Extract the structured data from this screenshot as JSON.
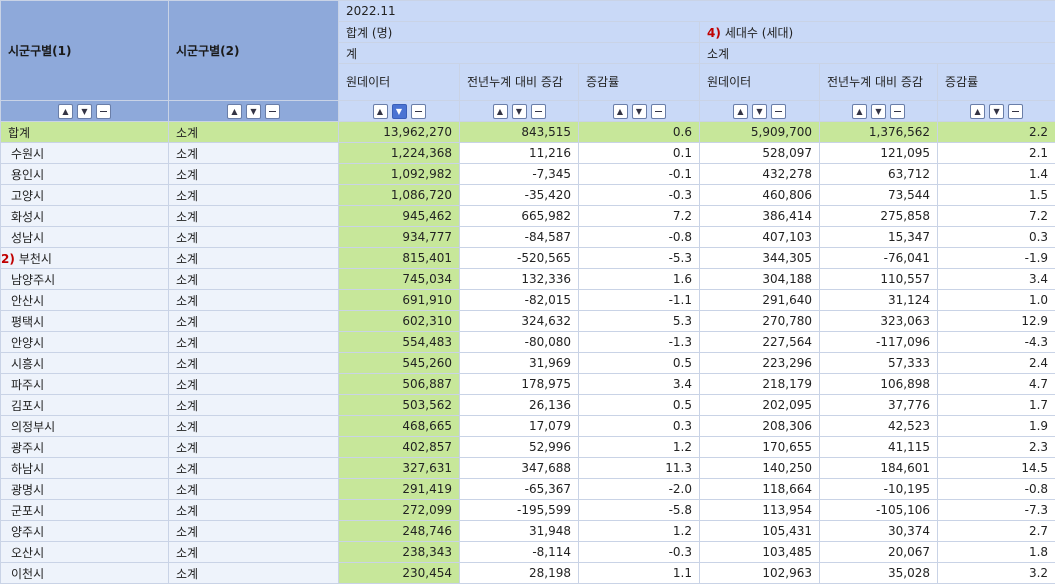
{
  "header": {
    "col1_label": "시군구별(1)",
    "col2_label": "시군구별(2)",
    "period": "2022.11",
    "group1_label": "합계 (명)",
    "group1_sub": "계",
    "group2_marker": "4)",
    "group2_label": "세대수 (세대)",
    "group2_sub": "소계",
    "metric_raw": "원데이터",
    "metric_change": "전년누계 대비 증감",
    "metric_rate": "증감률"
  },
  "rows": [
    {
      "region": "합계",
      "sub": "소계",
      "pop": "13,962,270",
      "pop_chg": "843,515",
      "pop_rate": "0.6",
      "hh": "5,909,700",
      "hh_chg": "1,376,562",
      "hh_rate": "2.2"
    },
    {
      "region": "수원시",
      "sub": "소계",
      "pop": "1,224,368",
      "pop_chg": "11,216",
      "pop_rate": "0.1",
      "hh": "528,097",
      "hh_chg": "121,095",
      "hh_rate": "2.1"
    },
    {
      "region": "용인시",
      "sub": "소계",
      "pop": "1,092,982",
      "pop_chg": "-7,345",
      "pop_rate": "-0.1",
      "hh": "432,278",
      "hh_chg": "63,712",
      "hh_rate": "1.4"
    },
    {
      "region": "고양시",
      "sub": "소계",
      "pop": "1,086,720",
      "pop_chg": "-35,420",
      "pop_rate": "-0.3",
      "hh": "460,806",
      "hh_chg": "73,544",
      "hh_rate": "1.5"
    },
    {
      "region": "화성시",
      "sub": "소계",
      "pop": "945,462",
      "pop_chg": "665,982",
      "pop_rate": "7.2",
      "hh": "386,414",
      "hh_chg": "275,858",
      "hh_rate": "7.2"
    },
    {
      "region": "성남시",
      "sub": "소계",
      "pop": "934,777",
      "pop_chg": "-84,587",
      "pop_rate": "-0.8",
      "hh": "407,103",
      "hh_chg": "15,347",
      "hh_rate": "0.3"
    },
    {
      "region": "부천시",
      "marker": "2)",
      "sub": "소계",
      "pop": "815,401",
      "pop_chg": "-520,565",
      "pop_rate": "-5.3",
      "hh": "344,305",
      "hh_chg": "-76,041",
      "hh_rate": "-1.9"
    },
    {
      "region": "남양주시",
      "sub": "소계",
      "pop": "745,034",
      "pop_chg": "132,336",
      "pop_rate": "1.6",
      "hh": "304,188",
      "hh_chg": "110,557",
      "hh_rate": "3.4"
    },
    {
      "region": "안산시",
      "sub": "소계",
      "pop": "691,910",
      "pop_chg": "-82,015",
      "pop_rate": "-1.1",
      "hh": "291,640",
      "hh_chg": "31,124",
      "hh_rate": "1.0"
    },
    {
      "region": "평택시",
      "sub": "소계",
      "pop": "602,310",
      "pop_chg": "324,632",
      "pop_rate": "5.3",
      "hh": "270,780",
      "hh_chg": "323,063",
      "hh_rate": "12.9"
    },
    {
      "region": "안양시",
      "sub": "소계",
      "pop": "554,483",
      "pop_chg": "-80,080",
      "pop_rate": "-1.3",
      "hh": "227,564",
      "hh_chg": "-117,096",
      "hh_rate": "-4.3"
    },
    {
      "region": "시흥시",
      "sub": "소계",
      "pop": "545,260",
      "pop_chg": "31,969",
      "pop_rate": "0.5",
      "hh": "223,296",
      "hh_chg": "57,333",
      "hh_rate": "2.4"
    },
    {
      "region": "파주시",
      "sub": "소계",
      "pop": "506,887",
      "pop_chg": "178,975",
      "pop_rate": "3.4",
      "hh": "218,179",
      "hh_chg": "106,898",
      "hh_rate": "4.7"
    },
    {
      "region": "김포시",
      "sub": "소계",
      "pop": "503,562",
      "pop_chg": "26,136",
      "pop_rate": "0.5",
      "hh": "202,095",
      "hh_chg": "37,776",
      "hh_rate": "1.7"
    },
    {
      "region": "의정부시",
      "sub": "소계",
      "pop": "468,665",
      "pop_chg": "17,079",
      "pop_rate": "0.3",
      "hh": "208,306",
      "hh_chg": "42,523",
      "hh_rate": "1.9"
    },
    {
      "region": "광주시",
      "sub": "소계",
      "pop": "402,857",
      "pop_chg": "52,996",
      "pop_rate": "1.2",
      "hh": "170,655",
      "hh_chg": "41,115",
      "hh_rate": "2.3"
    },
    {
      "region": "하남시",
      "sub": "소계",
      "pop": "327,631",
      "pop_chg": "347,688",
      "pop_rate": "11.3",
      "hh": "140,250",
      "hh_chg": "184,601",
      "hh_rate": "14.5"
    },
    {
      "region": "광명시",
      "sub": "소계",
      "pop": "291,419",
      "pop_chg": "-65,367",
      "pop_rate": "-2.0",
      "hh": "118,664",
      "hh_chg": "-10,195",
      "hh_rate": "-0.8"
    },
    {
      "region": "군포시",
      "sub": "소계",
      "pop": "272,099",
      "pop_chg": "-195,599",
      "pop_rate": "-5.8",
      "hh": "113,954",
      "hh_chg": "-105,106",
      "hh_rate": "-7.3"
    },
    {
      "region": "양주시",
      "sub": "소계",
      "pop": "248,746",
      "pop_chg": "31,948",
      "pop_rate": "1.2",
      "hh": "105,431",
      "hh_chg": "30,374",
      "hh_rate": "2.7"
    },
    {
      "region": "오산시",
      "sub": "소계",
      "pop": "238,343",
      "pop_chg": "-8,114",
      "pop_rate": "-0.3",
      "hh": "103,485",
      "hh_chg": "20,067",
      "hh_rate": "1.8"
    },
    {
      "region": "이천시",
      "sub": "소계",
      "pop": "230,454",
      "pop_chg": "28,198",
      "pop_rate": "1.1",
      "hh": "102,963",
      "hh_chg": "35,028",
      "hh_rate": "3.2"
    }
  ]
}
